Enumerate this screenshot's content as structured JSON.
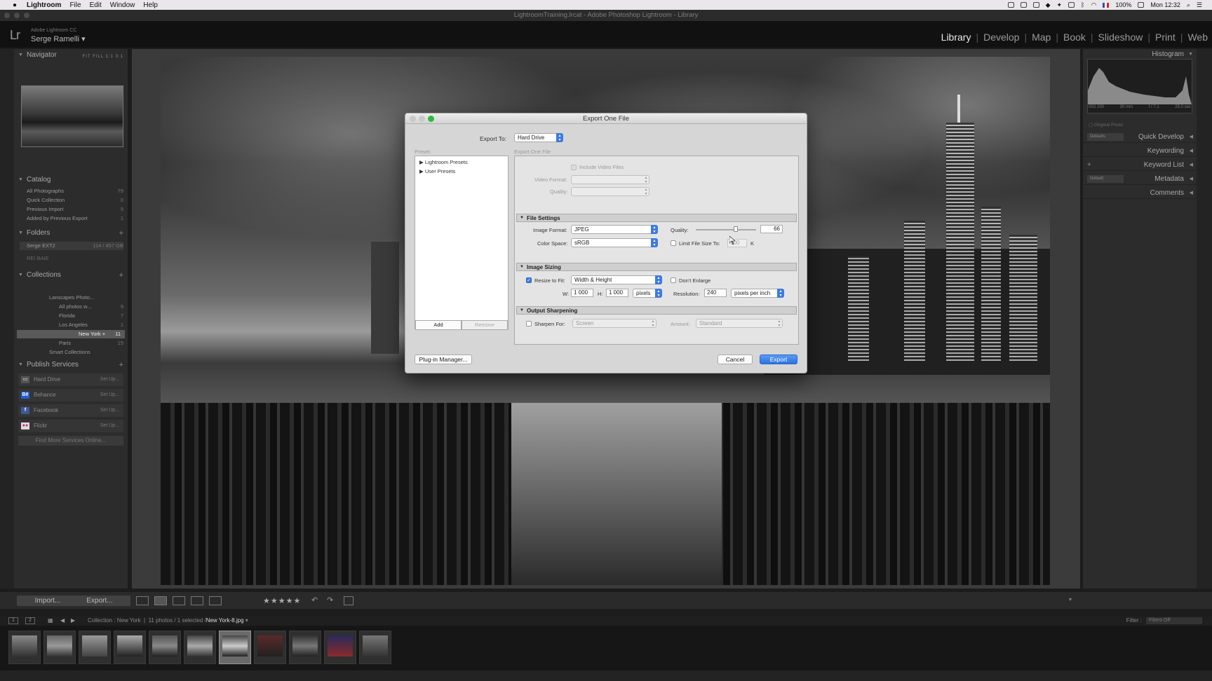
{
  "menubar": {
    "app": "Lightroom",
    "items": [
      "File",
      "Edit",
      "Window",
      "Help"
    ],
    "battery": "100%",
    "clock": "Mon 12:32"
  },
  "window": {
    "title": "LightroomTraining.lrcat - Adobe Photoshop Lightroom - Library"
  },
  "identity": {
    "product": "Adobe Lightroom CC",
    "user": "Serge Ramelli"
  },
  "modules": {
    "items": [
      "Library",
      "Develop",
      "Map",
      "Book",
      "Slideshow",
      "Print",
      "Web"
    ],
    "active": "Library"
  },
  "left": {
    "navigator": {
      "title": "Navigator",
      "zoom": "FIT   FILL   1:1   3:1"
    },
    "catalog": {
      "title": "Catalog",
      "items": [
        {
          "label": "All Photographs",
          "count": "79"
        },
        {
          "label": "Quick Collection",
          "count": "0"
        },
        {
          "label": "Previous Import",
          "count": "5"
        },
        {
          "label": "Added by Previous Export",
          "count": "1"
        }
      ]
    },
    "folders": {
      "title": "Folders",
      "drive": "Serge EXT2",
      "drive_info": "114 / 457 GB",
      "drive2": "REI BAIE"
    },
    "collections": {
      "title": "Collections",
      "items": [
        {
          "label": "Lanscapes Photo..."
        },
        {
          "label": "All photos w...",
          "count": "9"
        },
        {
          "label": "Florida",
          "count": "7"
        },
        {
          "label": "Los Angeles",
          "count": "1"
        },
        {
          "label": "New York +",
          "count": "11"
        },
        {
          "label": "Paris",
          "count": "15"
        },
        {
          "label": "Smart Collections"
        }
      ]
    },
    "publish": {
      "title": "Publish Services",
      "items": [
        {
          "label": "Hard Drive",
          "setup": "Set Up..."
        },
        {
          "label": "Behance",
          "setup": "Set Up..."
        },
        {
          "label": "Facebook",
          "setup": "Set Up..."
        },
        {
          "label": "Flickr",
          "setup": "Set Up..."
        }
      ],
      "find_more": "Find More Services Online..."
    }
  },
  "right": {
    "histogram": {
      "title": "Histogram",
      "iso": "ISO 200",
      "focal": "30 mm",
      "aperture": "f / 7.1",
      "shutter": "25.0 sec",
      "original": "Original Photo"
    },
    "sections": [
      "Quick Develop",
      "Keywording",
      "Keyword List",
      "Metadata",
      "Comments"
    ],
    "quick_develop_preset": "Defaults",
    "metadata_preset": "Default"
  },
  "toolbar": {
    "import": "Import...",
    "export": "Export...",
    "stars": "★★★★★"
  },
  "filmstrip_bar": {
    "source": "Collection : New York",
    "count": "11 photos / 1 selected /",
    "filename": "New York-8.jpg",
    "filter_label": "Filter :",
    "filter_value": "Filters Off"
  },
  "dialog": {
    "title": "Export One File",
    "export_to_label": "Export To:",
    "export_to_value": "Hard Drive",
    "preset_label": "Preset:",
    "section_label": "Export One File",
    "presets": [
      "Lightroom Presets",
      "User Presets"
    ],
    "add_label": "Add",
    "remove_label": "Remove",
    "video": {
      "include_label": "Include Video Files",
      "format_label": "Video Format:",
      "quality_label": "Quality:"
    },
    "file_settings": {
      "title": "File Settings",
      "format_label": "Image Format:",
      "format_value": "JPEG",
      "quality_label": "Quality:",
      "quality_value": "66",
      "quality_level": 0.66,
      "colorspace_label": "Color Space:",
      "colorspace_value": "sRGB",
      "limit_label": "Limit File Size To:",
      "limit_value": "100",
      "limit_unit": "K"
    },
    "image_sizing": {
      "title": "Image Sizing",
      "resize_label": "Resize to Fit:",
      "resize_value": "Width & Height",
      "enlarge_label": "Don't Enlarge",
      "w_label": "W:",
      "w_value": "1 000",
      "h_label": "H:",
      "h_value": "1 000",
      "unit_value": "pixels",
      "res_label": "Resolution:",
      "res_value": "240",
      "res_unit": "pixels per inch"
    },
    "output_sharpening": {
      "title": "Output Sharpening",
      "sharpen_label": "Sharpen For:",
      "sharpen_value": "Screen",
      "amount_label": "Amount:",
      "amount_value": "Standard"
    },
    "plugin_label": "Plug-in Manager...",
    "cancel_label": "Cancel",
    "export_label": "Export"
  }
}
